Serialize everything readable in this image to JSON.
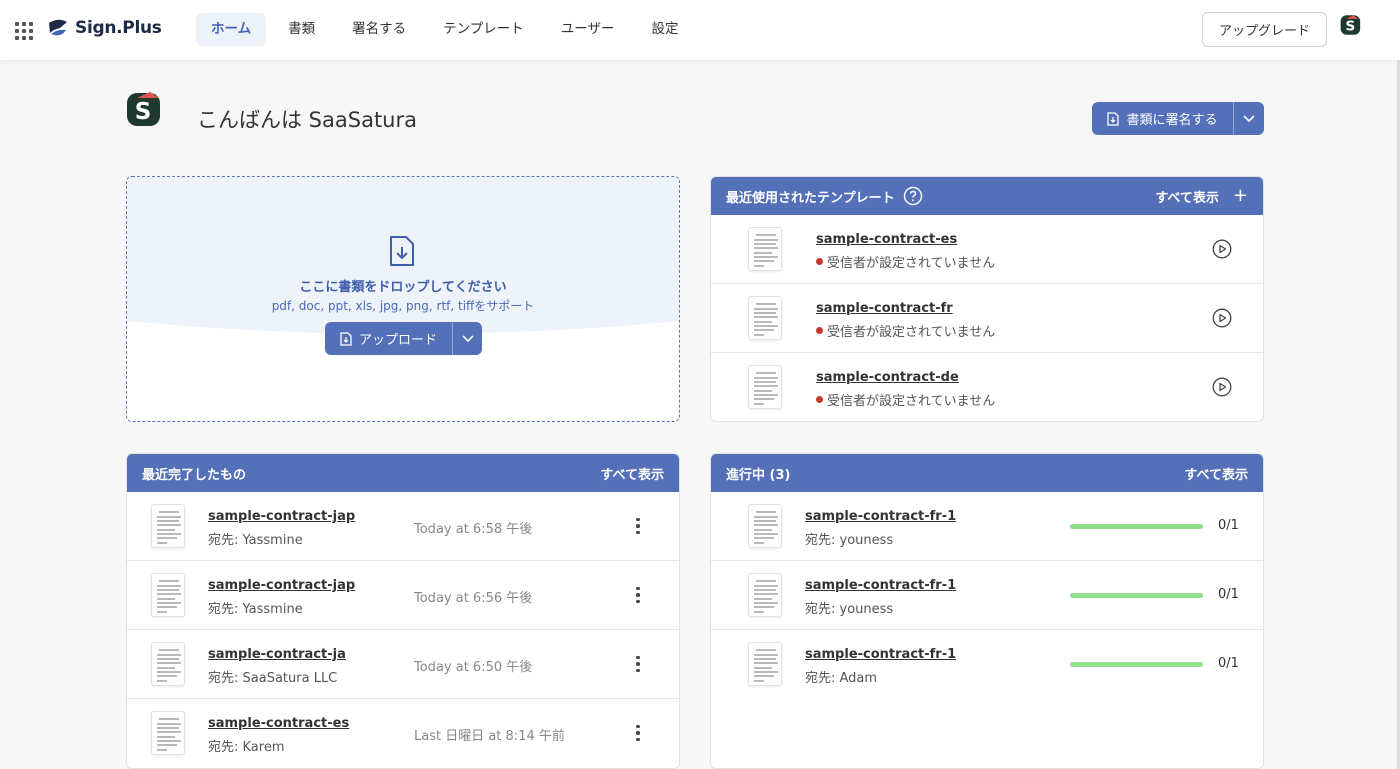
{
  "brand": {
    "name": "Sign.Plus"
  },
  "nav": [
    {
      "label": "ホーム",
      "active": true
    },
    {
      "label": "書類",
      "active": false
    },
    {
      "label": "署名する",
      "active": false
    },
    {
      "label": "テンプレート",
      "active": false
    },
    {
      "label": "ユーザー",
      "active": false
    },
    {
      "label": "設定",
      "active": false
    }
  ],
  "header": {
    "upgrade_label": "アップグレード"
  },
  "greeting": {
    "text": "こんばんは SaaSatura"
  },
  "sign_button": {
    "label": "書類に署名する"
  },
  "dropzone": {
    "title": "ここに書類をドロップしてください",
    "formats": "pdf, doc, ppt, xls, jpg, png, rtf, tiffをサポート",
    "upload_label": "アップロード"
  },
  "templates": {
    "title": "最近使用されたテンプレート",
    "view_all": "すべて表示",
    "plus": "+",
    "items": [
      {
        "name": "sample-contract-es",
        "status": "受信者が設定されていません"
      },
      {
        "name": "sample-contract-fr",
        "status": "受信者が設定されていません"
      },
      {
        "name": "sample-contract-de",
        "status": "受信者が設定されていません"
      }
    ]
  },
  "completed": {
    "title": "最近完了したもの",
    "view_all": "すべて表示",
    "items": [
      {
        "name": "sample-contract-jap",
        "recipient": "宛先: Yassmine",
        "time": "Today at 6:58 午後"
      },
      {
        "name": "sample-contract-jap",
        "recipient": "宛先: Yassmine",
        "time": "Today at 6:56 午後"
      },
      {
        "name": "sample-contract-ja",
        "recipient": "宛先: SaaSatura LLC",
        "time": "Today at 6:50 午後"
      },
      {
        "name": "sample-contract-es",
        "recipient": "宛先: Karem",
        "time": "Last 日曜日 at 8:14 午前"
      }
    ]
  },
  "in_progress": {
    "title": "進行中 (3)",
    "view_all": "すべて表示",
    "items": [
      {
        "name": "sample-contract-fr-1",
        "recipient": "宛先: youness",
        "count": "0/1",
        "progress": 1.0
      },
      {
        "name": "sample-contract-fr-1",
        "recipient": "宛先: youness",
        "count": "0/1",
        "progress": 1.0
      },
      {
        "name": "sample-contract-fr-1",
        "recipient": "宛先: Adam",
        "count": "0/1",
        "progress": 1.0
      }
    ]
  },
  "colors": {
    "primary": "#5470b8",
    "progress": "#8fde8a",
    "status_dot": "#c0392b",
    "avatar_bg": "#1e3a2e",
    "avatar_accent": "#e0574d"
  },
  "icons": {
    "apps": "grid-icon",
    "avatar": "avatar-logo-icon",
    "help": "help-circle-icon",
    "play": "play-circle-icon",
    "more": "kebab-icon",
    "upload": "file-upload-icon",
    "chevron": "chevron-down-icon"
  }
}
